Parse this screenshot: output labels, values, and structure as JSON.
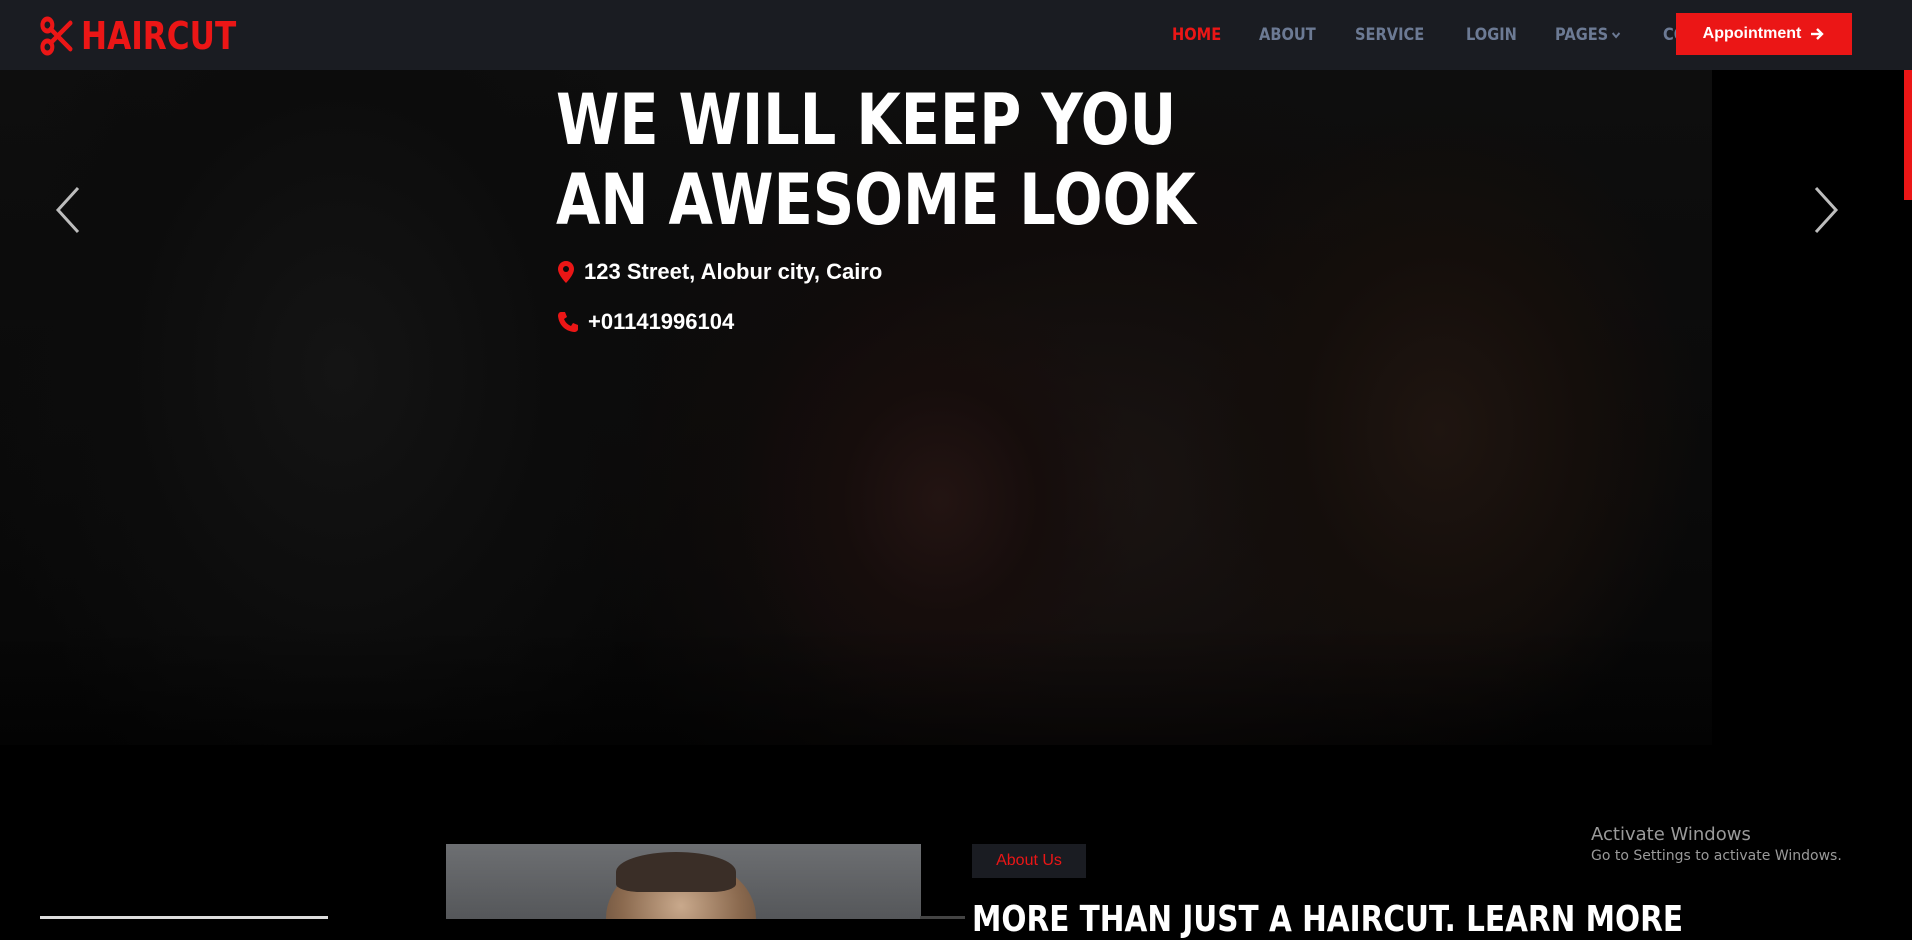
{
  "brand": {
    "name": "HAIRCUT",
    "accent": "#eb1616",
    "nav_bg": "#1a1c22"
  },
  "nav": {
    "items": [
      {
        "label": "HOME",
        "active": true
      },
      {
        "label": "ABOUT",
        "active": false
      },
      {
        "label": "SERVICE",
        "active": false
      },
      {
        "label": "LOGIN",
        "active": false
      },
      {
        "label": "PAGES",
        "active": false,
        "dropdown": true
      },
      {
        "label": "CONTACT",
        "active": false
      }
    ],
    "cta_label": "Appointment"
  },
  "hero": {
    "title": "WE WILL KEEP YOU AN AWESOME LOOK",
    "address": "123 Street, Alobur city, Cairo",
    "phone": "+01141996104"
  },
  "about": {
    "badge": "About Us",
    "heading": "MORE THAN JUST A HAIRCUT. LEARN MORE"
  },
  "watermark": {
    "line1": "Activate Windows",
    "line2": "Go to Settings to activate Windows."
  },
  "icons": {
    "logo": "scissors-icon",
    "address": "map-marker-icon",
    "phone": "phone-icon",
    "prev": "chevron-left-icon",
    "next": "chevron-right-icon",
    "dropdown": "chevron-down-icon",
    "cta": "arrow-right-icon"
  }
}
